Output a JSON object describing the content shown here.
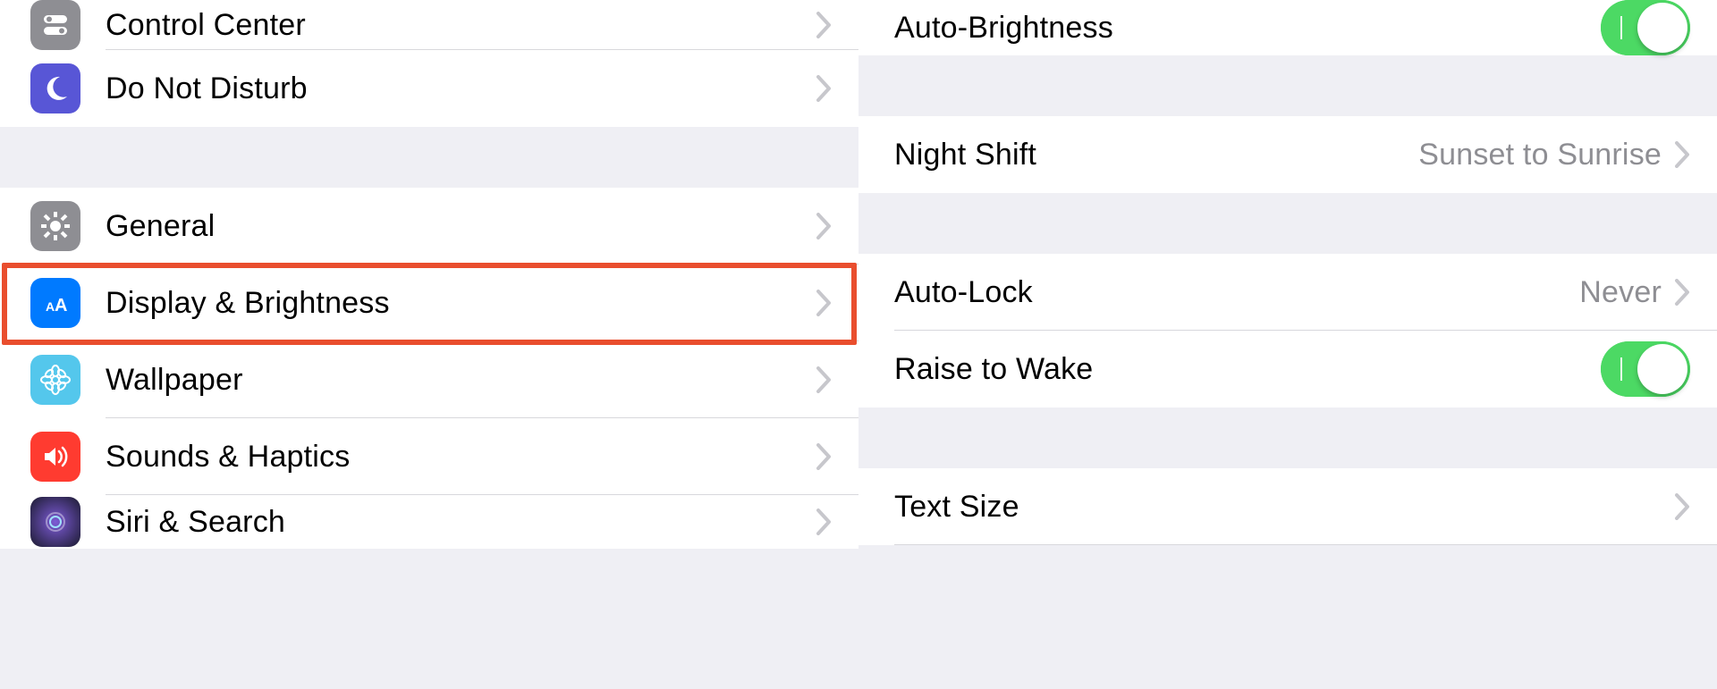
{
  "colors": {
    "highlight": "#e94e2e",
    "toggle_on": "#4cd964",
    "chevron": "#c7c7cc",
    "value_text": "#8e8e93",
    "icon_control_center": "#8e8e93",
    "icon_dnd": "#5856d6",
    "icon_general": "#8e8e93",
    "icon_display": "#007aff",
    "icon_wallpaper": "#54c7ec",
    "icon_sounds": "#ff3b30",
    "icon_siri": "#1c1c1e"
  },
  "left": {
    "group1": [
      {
        "label": "Control Center",
        "icon": "control-center"
      },
      {
        "label": "Do Not Disturb",
        "icon": "moon"
      }
    ],
    "group2": [
      {
        "label": "General",
        "icon": "gear"
      },
      {
        "label": "Display & Brightness",
        "icon": "text-size",
        "highlighted": true
      },
      {
        "label": "Wallpaper",
        "icon": "flower"
      },
      {
        "label": "Sounds & Haptics",
        "icon": "speaker"
      },
      {
        "label": "Siri & Search",
        "icon": "siri"
      }
    ]
  },
  "right": {
    "auto_brightness": {
      "label": "Auto-Brightness",
      "on": true
    },
    "night_shift": {
      "label": "Night Shift",
      "value": "Sunset to Sunrise"
    },
    "auto_lock": {
      "label": "Auto-Lock",
      "value": "Never"
    },
    "raise_to_wake": {
      "label": "Raise to Wake",
      "on": true
    },
    "text_size": {
      "label": "Text Size"
    }
  }
}
